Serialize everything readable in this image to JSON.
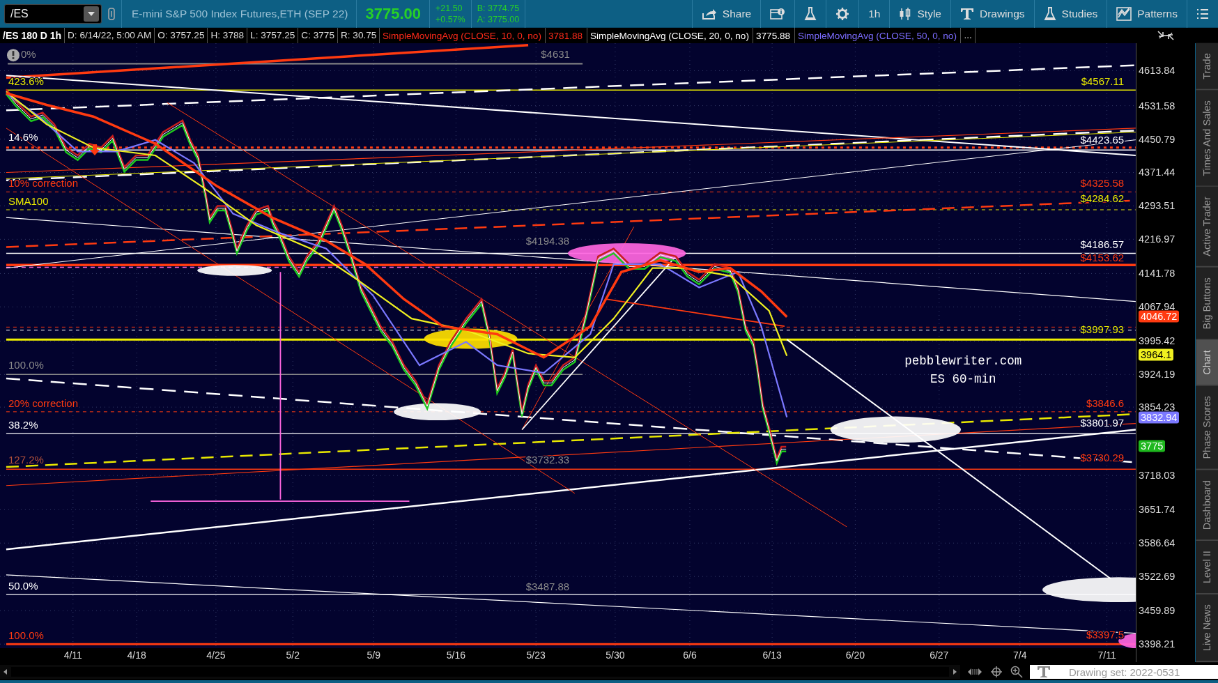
{
  "toolbar": {
    "symbol": "/ES",
    "description": "E-mini S&P 500 Index Futures,ETH (SEP 22)",
    "last": "3775.00",
    "change": "+21.50",
    "change_pct": "+0.57%",
    "bid": "B: 3774.75",
    "ask": "A: 3775.00",
    "buttons": [
      {
        "kind": "share",
        "label": "Share"
      },
      {
        "kind": "info"
      },
      {
        "kind": "flask"
      },
      {
        "kind": "gear"
      },
      {
        "kind": "plain",
        "label": "1h"
      },
      {
        "kind": "candles",
        "label": "Style"
      },
      {
        "kind": "text",
        "label": "Drawings"
      },
      {
        "kind": "flask",
        "label": "Studies"
      },
      {
        "kind": "pattern",
        "label": "Patterns"
      },
      {
        "kind": "list"
      }
    ]
  },
  "legend": [
    {
      "kind": "title",
      "text": "/ES 180 D 1h"
    },
    {
      "kind": "info",
      "text": "D: 6/14/22, 5:00 AM"
    },
    {
      "kind": "info",
      "text": "O: 3757.25"
    },
    {
      "kind": "info",
      "text": "H: 3788"
    },
    {
      "kind": "info",
      "text": "L: 3757.25"
    },
    {
      "kind": "info",
      "text": "C: 3775"
    },
    {
      "kind": "info",
      "text": "R: 30.75"
    },
    {
      "kind": "study",
      "text": "SimpleMovingAvg (CLOSE, 10, 0, no)",
      "color": "#ff2a1a"
    },
    {
      "kind": "study",
      "text": "3781.88",
      "color": "#ff2a1a"
    },
    {
      "kind": "study",
      "text": "SimpleMovingAvg (CLOSE, 20, 0, no)",
      "color": "#ffffff"
    },
    {
      "kind": "study",
      "text": "3775.88",
      "color": "#ffffff"
    },
    {
      "kind": "study",
      "text": "SimpleMovingAvg (CLOSE, 50, 0, no)",
      "color": "#7b6cff"
    },
    {
      "kind": "info",
      "text": "..."
    }
  ],
  "chart": {
    "left_labels": [
      {
        "text": "0%",
        "color": "#8a8a8a"
      },
      {
        "text": "423.6%",
        "color": "#e8e800"
      },
      {
        "text": "14.6%",
        "color": "#ffffff"
      },
      {
        "text": "10% correction",
        "color": "#ff3a10"
      },
      {
        "text": "SMA100",
        "color": "#e8e800"
      },
      {
        "text": "100.0%",
        "color": "#8a8a8a"
      },
      {
        "text": "20% correction",
        "color": "#ff3a10"
      },
      {
        "text": "38.2%",
        "color": "#ffffff"
      },
      {
        "text": "127.2%",
        "color": "#b0503a"
      },
      {
        "text": "50.0%",
        "color": "#ffffff"
      },
      {
        "text": "100.0%",
        "color": "#ff3a10"
      }
    ],
    "price_labels": [
      {
        "text": "$4631",
        "color": "#8a8a8a"
      },
      {
        "text": "$4567.11",
        "color": "#e8e800"
      },
      {
        "text": "$4423.65",
        "color": "#ffffff"
      },
      {
        "text": "$4325.58",
        "color": "#ff3a10"
      },
      {
        "text": "$4284.62",
        "color": "#e8e800"
      },
      {
        "text": "$4194.38",
        "color": "#8a8a8a"
      },
      {
        "text": "$4186.57",
        "color": "#ffffff"
      },
      {
        "text": "$4153.62",
        "color": "#ff3a10"
      },
      {
        "text": "$3997.93",
        "color": "#e8e800"
      },
      {
        "text": "$3846.6",
        "color": "#ff3a10"
      },
      {
        "text": "$3801.97",
        "color": "#ffffff"
      },
      {
        "text": "$3732.33",
        "color": "#8a8a8a"
      },
      {
        "text": "$3730.29",
        "color": "#ff3a10"
      },
      {
        "text": "$3487.88",
        "color": "#8a8a8a"
      },
      {
        "text": "$3397.5",
        "color": "#ff3a10"
      }
    ],
    "note": [
      "pebblewriter.com",
      "ES 60-min"
    ],
    "price_axis": [
      "4613.84",
      "4531.58",
      "4450.79",
      "4371.44",
      "4293.51",
      "4216.97",
      "4141.78",
      "4067.94",
      "3995.42",
      "3924.19",
      "3854.23",
      "3718.03",
      "3651.74",
      "3586.64",
      "3522.69",
      "3459.89",
      "3398.21"
    ],
    "badges": [
      {
        "text": "4046.72",
        "color": "#ff3a10"
      },
      {
        "text": "3964.1",
        "color": "#f0f020"
      },
      {
        "text": "3832.94",
        "color": "#7b78ff"
      },
      {
        "text": "3775",
        "color": "#1eb81e"
      }
    ],
    "date_axis": [
      "4/11",
      "4/18",
      "4/25",
      "5/2",
      "5/9",
      "5/16",
      "5/23",
      "5/30",
      "6/6",
      "6/13",
      "6/20",
      "6/27",
      "7/4",
      "7/11"
    ]
  },
  "side_tabs": [
    {
      "label": "Trade",
      "selected": false
    },
    {
      "label": "Times And Sales",
      "selected": false
    },
    {
      "label": "Active Trader",
      "selected": false
    },
    {
      "label": "Big Buttons",
      "selected": false
    },
    {
      "label": "Chart",
      "selected": true
    },
    {
      "label": "Phase Scores",
      "selected": false
    },
    {
      "label": "Dashboard",
      "selected": false
    },
    {
      "label": "Level II",
      "selected": false
    },
    {
      "label": "Live News",
      "selected": false
    }
  ],
  "status": {
    "drawing_set": "Drawing set: 2022-0531"
  }
}
